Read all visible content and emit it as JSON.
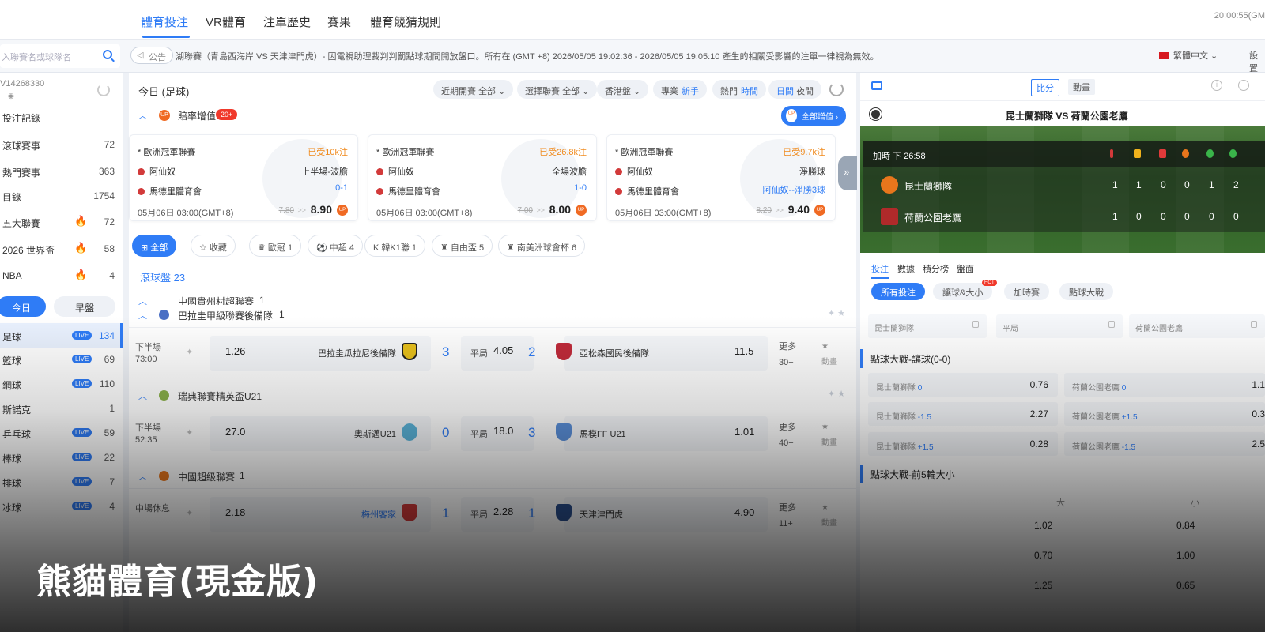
{
  "topnav": {
    "items": [
      "體育投注",
      "VR體育",
      "注單歷史",
      "賽果",
      "體育競猜規則"
    ],
    "clock": "20:00:55(GM"
  },
  "search": {
    "placeholder": "入聯賽名或球隊名"
  },
  "notice": {
    "tag": "公告",
    "text": "湖聯賽（青島西海岸 VS 天津津門虎）- 因電視助理裁判判罰點球期間開放盤口。所有在 (GMT +8) 2026/05/05 19:02:36 - 2026/05/05 19:05:10 產生的相關受影響的注單一律視為無效。"
  },
  "language": "繁體中文",
  "settings": "設置",
  "sidebar": {
    "account": "V14268330",
    "rows": [
      {
        "label": "投注記錄",
        "count": ""
      },
      {
        "label": "滾球賽事",
        "count": "72"
      },
      {
        "label": "熱門賽事",
        "count": "363"
      },
      {
        "label": "目錄",
        "count": "1754"
      },
      {
        "label": "五大聯賽",
        "count": "72"
      },
      {
        "label": "2026 世界盃",
        "count": "58"
      },
      {
        "label": "NBA",
        "count": "4"
      }
    ],
    "day_tabs": [
      "今日",
      "早盤"
    ],
    "sports": [
      {
        "label": "足球",
        "count": "134"
      },
      {
        "label": "籃球",
        "count": "69"
      },
      {
        "label": "網球",
        "count": "110"
      },
      {
        "label": "斯諾克",
        "count": "1"
      },
      {
        "label": "乒乓球",
        "count": "59"
      },
      {
        "label": "棒球",
        "count": "22"
      },
      {
        "label": "排球",
        "count": "7"
      },
      {
        "label": "冰球",
        "count": "4"
      }
    ],
    "live_label": "LIVE"
  },
  "main": {
    "title": "今日 (足球)",
    "filters": [
      {
        "label": "近期開賽",
        "value": "全部"
      },
      {
        "label": "選擇聯賽",
        "value": "全部"
      },
      {
        "label": "香港盤",
        "value": ""
      }
    ],
    "toggles": [
      {
        "a": "專業",
        "b": "新手"
      },
      {
        "a": "熱門",
        "b": "時間"
      },
      {
        "a": "日間",
        "b": "夜間"
      }
    ],
    "boost": {
      "title": "賠率增值",
      "count": "20+",
      "all_label": "全部增值"
    },
    "cards": [
      {
        "league": "* 歐洲冠軍聯賽",
        "hot": "已受10k注",
        "home": "阿仙奴",
        "away": "馬德里體育會",
        "market": "上半場-波膽",
        "pick": "0-1",
        "date": "05月06日 03:00(GMT+8)",
        "old": "7.80",
        "new": "8.90"
      },
      {
        "league": "* 歐洲冠軍聯賽",
        "hot": "已受26.8k注",
        "home": "阿仙奴",
        "away": "馬德里體育會",
        "market": "全場波膽",
        "pick": "1-0",
        "date": "05月06日 03:00(GMT+8)",
        "old": "7.00",
        "new": "8.00"
      },
      {
        "league": "* 歐洲冠軍聯賽",
        "hot": "已受9.7k注",
        "home": "阿仙奴",
        "away": "馬德里體育會",
        "market": "淨勝球",
        "pick": "阿仙奴--淨勝3球",
        "date": "05月06日 03:00(GMT+8)",
        "old": "8.20",
        "new": "9.40"
      }
    ],
    "arrow_sep": ">>",
    "up_label": "UP",
    "league_filters": [
      {
        "label": "全部"
      },
      {
        "label": "收藏"
      },
      {
        "label": "歐冠 1"
      },
      {
        "label": "中超 4"
      },
      {
        "label": "韓K1聯 1"
      },
      {
        "label": "自由盃 5"
      },
      {
        "label": "南美洲球會杯 6"
      }
    ],
    "live_title": "滾球盤 23",
    "leagues": [
      {
        "name": "中國貴州村超聯賽",
        "count": "1"
      },
      {
        "name": "巴拉圭甲級聯賽後備隊",
        "count": "1"
      },
      {
        "name": "瑞典聯賽精英盃U21",
        "count": "1"
      },
      {
        "name": "中國超級聯賽",
        "count": "1"
      }
    ],
    "matches": [
      {
        "time1": "下半場",
        "time2": "73:00",
        "home_odds": "1.26",
        "home": "巴拉圭瓜拉尼後備隊",
        "home_score": "3",
        "draw": "平局",
        "draw_odds": "4.05",
        "away_score": "2",
        "away": "亞松森國民後備隊",
        "away_odds": "11.5",
        "more1": "更多",
        "more2": "30+",
        "anim": "動畫"
      },
      {
        "time1": "下半場",
        "time2": "52:35",
        "home_odds": "27.0",
        "home": "奧斯邁U21",
        "home_score": "0",
        "draw": "平局",
        "draw_odds": "18.0",
        "away_score": "3",
        "away": "馬模FF U21",
        "away_odds": "1.01",
        "more1": "更多",
        "more2": "40+",
        "anim": "動畫"
      },
      {
        "time1": "中場休息",
        "time2": "",
        "home_odds": "2.18",
        "home": "梅州客家",
        "home_score": "1",
        "draw": "平局",
        "draw_odds": "2.28",
        "away_score": "1",
        "away": "天津津門虎",
        "away_odds": "4.90",
        "more1": "更多",
        "more2": "11+",
        "anim": "動畫"
      }
    ]
  },
  "right": {
    "tabs_top": [
      "比分",
      "動畫"
    ],
    "match_title": "昆士蘭獅隊 VS 荷蘭公園老鷹",
    "period": "加時 下  26:58",
    "teams": [
      {
        "name": "昆士蘭獅隊",
        "stats": [
          "1",
          "1",
          "0",
          "0",
          "1",
          "2"
        ]
      },
      {
        "name": "荷蘭公園老鷹",
        "stats": [
          "1",
          "0",
          "0",
          "0",
          "0",
          "0"
        ]
      }
    ],
    "tabs": [
      "投注",
      "數據",
      "積分榜",
      "盤面"
    ],
    "pills": [
      "所有投注",
      "讓球&大小",
      "加時賽",
      "點球大戰"
    ],
    "hot_label": "HOT",
    "locked": [
      "昆士蘭獅隊",
      "平局",
      "荷蘭公園老鷹"
    ],
    "section1": "點球大戰-讓球(0-0)",
    "handicap": [
      {
        "left": "昆士蘭獅隊",
        "lh": "0",
        "lo": "0.76",
        "right": "荷蘭公園老鷹",
        "rh": "0",
        "ro": "1.1"
      },
      {
        "left": "昆士蘭獅隊",
        "lh": "-1.5",
        "lo": "2.27",
        "right": "荷蘭公園老鷹",
        "rh": "+1.5",
        "ro": "0.3"
      },
      {
        "left": "昆士蘭獅隊",
        "lh": "+1.5",
        "lo": "0.28",
        "right": "荷蘭公園老鷹",
        "rh": "-1.5",
        "ro": "2.5"
      }
    ],
    "section2": "點球大戰-前5輪大小",
    "ou_head": [
      "大",
      "小"
    ],
    "ou": [
      {
        "o": "1.02",
        "u": "0.84"
      },
      {
        "o": "0.70",
        "u": "1.00"
      },
      {
        "o": "1.25",
        "u": "0.65"
      }
    ]
  },
  "banner": "熊貓體育(現金版)"
}
